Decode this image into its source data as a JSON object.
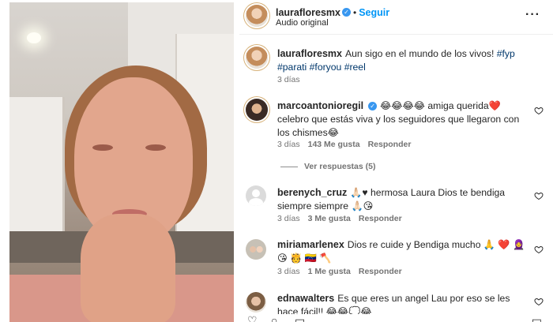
{
  "header": {
    "username": "laurafloresmx",
    "follow_label": "Seguir",
    "dot": "•",
    "subtitle": "Audio original",
    "more_label": "···"
  },
  "caption": {
    "username": "laurafloresmx",
    "text": "Aun sigo en el mundo de los vivos!",
    "hashtags": "#fyp #parati #foryou #reel",
    "time": "3 días"
  },
  "comments": [
    {
      "username": "marcoantonioregil",
      "verified": true,
      "text": "😂😂😂😂 amiga querida❤️ celebro que estás viva y los seguidores que llegaron con los chismes😂",
      "time": "3 días",
      "likes": "143 Me gusta",
      "reply": "Responder",
      "view_replies": "Ver respuestas (5)"
    },
    {
      "username": "berenych_cruz",
      "text": "🙏🏻♥ hermosa Laura Dios te bendiga siempre siempre 🙏🏻😘",
      "time": "3 días",
      "likes": "3 Me gusta",
      "reply": "Responder"
    },
    {
      "username": "miriamarlenex",
      "text": "Dios re cuide y Bendiga mucho 🙏 ❤️ 🧕 😘 🫅 🇻🇪 🪓",
      "time": "3 días",
      "likes": "1 Me gusta",
      "reply": "Responder"
    },
    {
      "username": "ednawalters",
      "text": "Es que eres un angel Lau por eso se les hace fácil!! 😂😂💭😂"
    }
  ],
  "icons": {
    "verified": "verified-badge-icon",
    "heart": "heart-outline-icon",
    "more": "more-options-icon"
  },
  "colors": {
    "follow": "#0095f6",
    "verified": "#3897f0",
    "meta": "#737373"
  }
}
